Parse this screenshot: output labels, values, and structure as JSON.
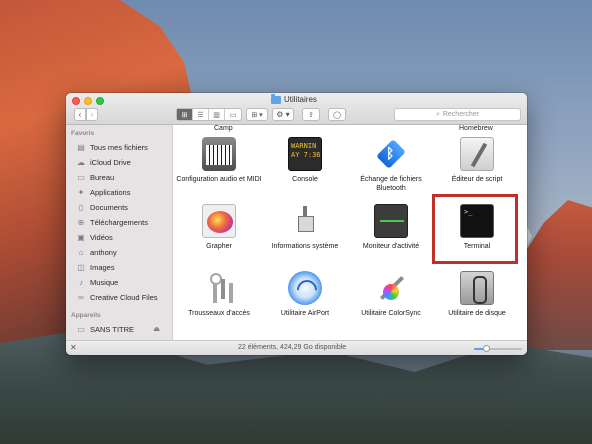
{
  "window": {
    "title": "Utilitaires"
  },
  "toolbar": {
    "back": "‹",
    "forward": "›",
    "views": [
      "⊞",
      "☰",
      "▥",
      "▭"
    ],
    "arrange": "⊞ ▾",
    "action": "⚙ ▾",
    "share": "⇪",
    "tag": "◯",
    "search_placeholder": "Rechercher"
  },
  "sidebar": {
    "favorites_heading": "Favoris",
    "favorites": [
      {
        "label": "Tous mes fichiers",
        "icon": "all-files-icon"
      },
      {
        "label": "iCloud Drive",
        "icon": "cloud-icon"
      },
      {
        "label": "Bureau",
        "icon": "desktop-icon"
      },
      {
        "label": "Applications",
        "icon": "applications-icon"
      },
      {
        "label": "Documents",
        "icon": "documents-icon"
      },
      {
        "label": "Téléchargements",
        "icon": "download-icon"
      },
      {
        "label": "Vidéos",
        "icon": "video-icon"
      },
      {
        "label": "anthony",
        "icon": "home-icon"
      },
      {
        "label": "Images",
        "icon": "images-icon"
      },
      {
        "label": "Musique",
        "icon": "music-icon"
      },
      {
        "label": "Creative Cloud Files",
        "icon": "creative-cloud-icon"
      }
    ],
    "devices_heading": "Appareils",
    "devices": [
      {
        "label": "SANS TITRE",
        "icon": "drive-icon",
        "eject": "⏏"
      }
    ]
  },
  "content": {
    "partial_top_labels": [
      "Camp",
      "Homebrew"
    ],
    "apps": [
      {
        "label": "Configuration audio et MIDI",
        "icon": "audio-midi-icon"
      },
      {
        "label": "Console",
        "icon": "console-icon",
        "icon_text": "WARNIN\nAY 7:36"
      },
      {
        "label": "Échange de fichiers Bluetooth",
        "icon": "bluetooth-icon"
      },
      {
        "label": "Éditeur de script",
        "icon": "script-editor-icon"
      },
      {
        "label": "Grapher",
        "icon": "grapher-icon"
      },
      {
        "label": "Informations système",
        "icon": "system-info-icon"
      },
      {
        "label": "Moniteur d'activité",
        "icon": "activity-monitor-icon"
      },
      {
        "label": "Terminal",
        "icon": "terminal-icon",
        "icon_text": ">_"
      },
      {
        "label": "Trousseaux d'accès",
        "icon": "keychain-icon"
      },
      {
        "label": "Utilitaire AirPort",
        "icon": "airport-icon"
      },
      {
        "label": "Utilitaire ColorSync",
        "icon": "colorsync-icon"
      },
      {
        "label": "Utilitaire de disque",
        "icon": "disk-utility-icon"
      }
    ],
    "highlight_color": "#c0302a"
  },
  "statusbar": {
    "text": "22 éléments, 424,29 Go disponible",
    "close_glyph": "✕",
    "icon_size_fraction": 0.25
  }
}
